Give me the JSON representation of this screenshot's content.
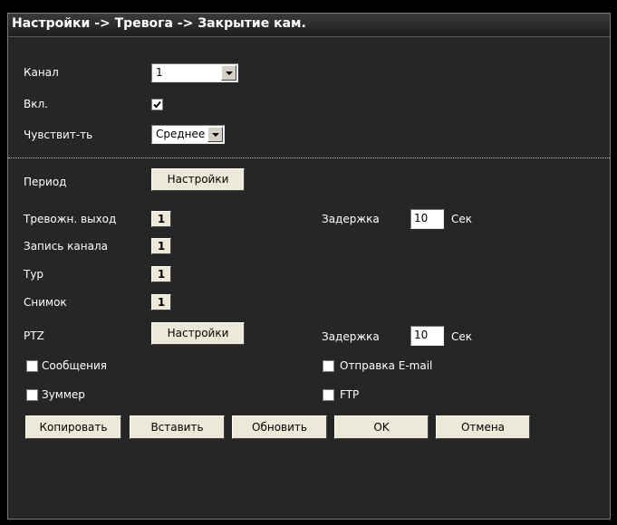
{
  "title": "Настройки -> Тревога -> Закрытие кам.",
  "channel": {
    "label": "Канал",
    "value": "1"
  },
  "enable": {
    "label": "Вкл.",
    "checked": true
  },
  "sensitivity": {
    "label": "Чувствит-ть",
    "value": "Среднее"
  },
  "period": {
    "label": "Период",
    "button": "Настройки"
  },
  "alarm_out": {
    "label": "Тревожн. выход",
    "channel": "1",
    "delay_label": "Задержка",
    "delay_value": "10",
    "unit": "Сек"
  },
  "record_channel": {
    "label": "Запись канала",
    "channel": "1"
  },
  "tour": {
    "label": "Тур",
    "channel": "1"
  },
  "snapshot": {
    "label": "Снимок",
    "channel": "1"
  },
  "ptz": {
    "label": "PTZ",
    "button": "Настройки",
    "delay_label": "Задержка",
    "delay_value": "10",
    "unit": "Сек"
  },
  "messages": {
    "label": "Сообщения",
    "checked": false
  },
  "email": {
    "label": "Отправка E-mail",
    "checked": false
  },
  "buzzer": {
    "label": "Зуммер",
    "checked": false
  },
  "ftp": {
    "label": "FTP",
    "checked": false
  },
  "buttons": {
    "copy": "Копировать",
    "paste": "Вставить",
    "refresh": "Обновить",
    "ok": "OK",
    "cancel": "Отмена"
  }
}
